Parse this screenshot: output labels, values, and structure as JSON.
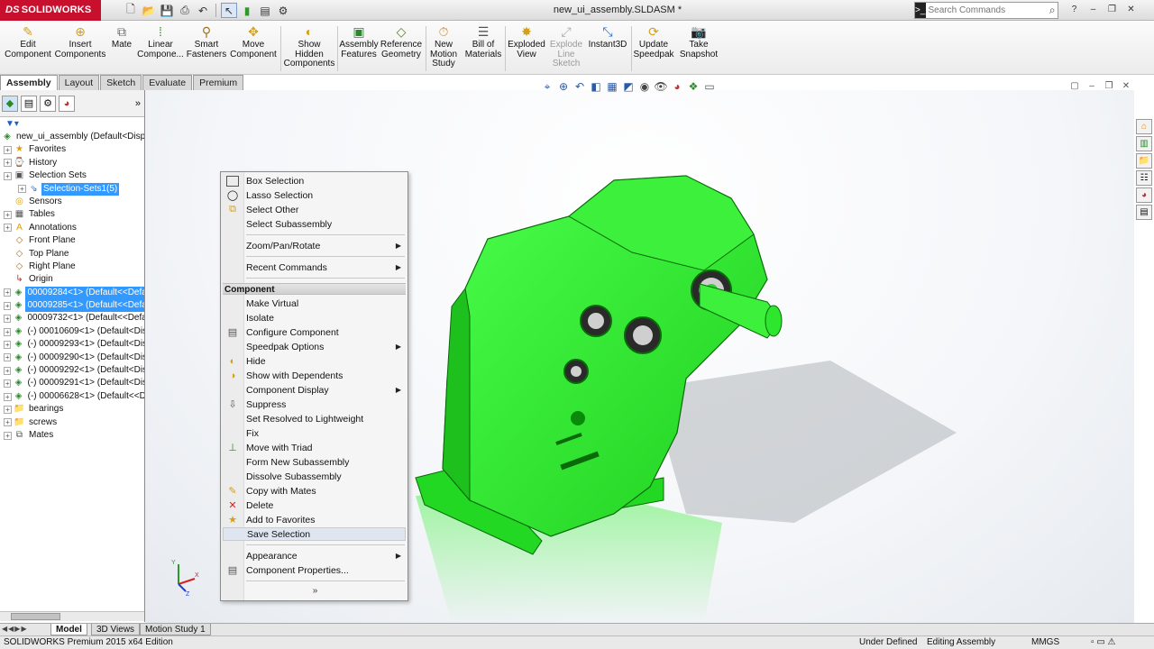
{
  "app": {
    "logo_brand": "SOLIDWORKS",
    "document_title": "new_ui_assembly.SLDASM *",
    "search_placeholder": "Search Commands"
  },
  "command_manager": {
    "edit_component": "Edit\nComponent",
    "insert_components": "Insert\nComponents",
    "mate": "Mate",
    "linear_component": "Linear\nCompone...",
    "smart_fasteners": "Smart\nFasteners",
    "move_component": "Move\nComponent",
    "show_hidden": "Show\nHidden\nComponents",
    "assembly_features": "Assembly\nFeatures",
    "reference_geometry": "Reference\nGeometry",
    "new_motion_study": "New\nMotion\nStudy",
    "bill_of_materials": "Bill of\nMaterials",
    "exploded_view": "Exploded\nView",
    "explode_line_sketch": "Explode\nLine\nSketch",
    "instant3d": "Instant3D",
    "update_speedpak": "Update\nSpeedpak",
    "take_snapshot": "Take\nSnapshot"
  },
  "tabs": [
    "Assembly",
    "Layout",
    "Sketch",
    "Evaluate",
    "Premium"
  ],
  "tree": {
    "root": "new_ui_assembly  (Default<Displa",
    "items": [
      {
        "label": "Favorites",
        "icon": "folder-star-icon",
        "exp": true
      },
      {
        "label": "History",
        "icon": "history-icon",
        "exp": true
      },
      {
        "label": "Selection Sets",
        "icon": "selection-sets-icon",
        "exp": true
      },
      {
        "label": "Selection-Sets1(5)",
        "icon": "selection-set-icon",
        "exp": true,
        "indent": true,
        "selected": true
      },
      {
        "label": "Sensors",
        "icon": "sensor-icon",
        "exp": false
      },
      {
        "label": "Tables",
        "icon": "table-icon",
        "exp": true
      },
      {
        "label": "Annotations",
        "icon": "annotation-icon",
        "exp": true
      },
      {
        "label": "Front Plane",
        "icon": "plane-icon",
        "exp": false
      },
      {
        "label": "Top Plane",
        "icon": "plane-icon",
        "exp": false
      },
      {
        "label": "Right Plane",
        "icon": "plane-icon",
        "exp": false
      },
      {
        "label": "Origin",
        "icon": "origin-icon",
        "exp": false
      },
      {
        "label": "00009284<1> (Default<<Defau",
        "icon": "part-icon",
        "exp": true,
        "selected": true
      },
      {
        "label": "00009285<1> (Default<<Defau",
        "icon": "part-icon",
        "exp": true,
        "selected": true
      },
      {
        "label": "00009732<1> (Default<<Defau",
        "icon": "part-icon",
        "exp": true
      },
      {
        "label": "(-) 00010609<1> (Default<Disp",
        "icon": "part-icon",
        "exp": true
      },
      {
        "label": "(-) 00009293<1> (Default<Disp",
        "icon": "part-icon",
        "exp": true
      },
      {
        "label": "(-) 00009290<1> (Default<Disp",
        "icon": "part-icon",
        "exp": true
      },
      {
        "label": "(-) 00009292<1> (Default<Disp",
        "icon": "part-icon",
        "exp": true
      },
      {
        "label": "(-) 00009291<1> (Default<Disp",
        "icon": "part-icon",
        "exp": true
      },
      {
        "label": "(-) 00006628<1> (Default<<De",
        "icon": "part-icon",
        "exp": true
      },
      {
        "label": "bearings",
        "icon": "folder-icon",
        "exp": true
      },
      {
        "label": "screws",
        "icon": "folder-icon",
        "exp": true
      },
      {
        "label": "Mates",
        "icon": "mates-icon",
        "exp": true
      }
    ]
  },
  "context_menu": {
    "header": "Component",
    "more_glyph": "»",
    "items": {
      "box_selection": "Box Selection",
      "lasso_selection": "Lasso Selection",
      "select_other": "Select Other",
      "select_subassembly": "Select Subassembly",
      "zoom_pan_rotate": "Zoom/Pan/Rotate",
      "recent_commands": "Recent Commands",
      "make_virtual": "Make Virtual",
      "isolate": "Isolate",
      "configure_component": "Configure Component",
      "speedpak_options": "Speedpak Options",
      "hide": "Hide",
      "show_with_dependents": "Show with Dependents",
      "component_display": "Component Display",
      "suppress": "Suppress",
      "set_resolved_lightweight": "Set Resolved to Lightweight",
      "fix": "Fix",
      "move_with_triad": "Move with Triad",
      "form_new_subassembly": "Form New Subassembly",
      "dissolve_subassembly": "Dissolve Subassembly",
      "copy_with_mates": "Copy with Mates",
      "delete": "Delete",
      "add_to_favorites": "Add to Favorites",
      "save_selection": "Save Selection",
      "appearance": "Appearance",
      "component_properties": "Component Properties..."
    }
  },
  "bottom_tabs": [
    "Model",
    "3D Views",
    "Motion Study 1"
  ],
  "status": {
    "edition": "SOLIDWORKS Premium 2015 x64 Edition",
    "definition": "Under Defined",
    "mode": "Editing Assembly",
    "units": "MMGS"
  },
  "triad": {
    "y": "Y",
    "x": "X",
    "z": "Z"
  },
  "colors": {
    "model_green": "#2ee62e",
    "selection_blue": "#3399ff",
    "brand_red": "#c8102e"
  }
}
